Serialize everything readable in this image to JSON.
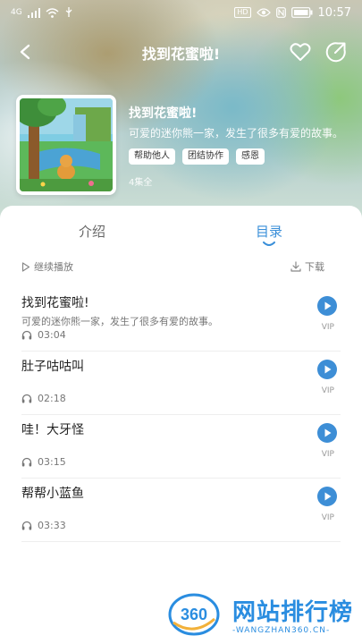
{
  "status_bar": {
    "network": "4G",
    "hd_badge": "HD",
    "battery_icon": "battery-icon",
    "time": "10:57"
  },
  "nav": {
    "title": "找到花蜜啦!",
    "back_icon": "back-arrow-icon",
    "favorite_icon": "heart-icon",
    "share_icon": "share-icon"
  },
  "album": {
    "title": "找到花蜜啦!",
    "description": "可爱的迷你熊一家，发生了很多有爱的故事。",
    "tags": [
      "帮助他人",
      "团结协作",
      "感恩"
    ],
    "episode_count": "4集全"
  },
  "tabs": {
    "intro_label": "介绍",
    "list_label": "目录"
  },
  "toolbar": {
    "continue_label": "继续播放",
    "download_label": "下载"
  },
  "episodes": [
    {
      "title": "找到花蜜啦!",
      "description": "可爱的迷你熊一家，发生了很多有爱的故事。",
      "duration": "03:04",
      "badge": "VIP"
    },
    {
      "title": "肚子咕咕叫",
      "description": "",
      "duration": "02:18",
      "badge": "VIP"
    },
    {
      "title": "哇！大牙怪",
      "description": "",
      "duration": "03:15",
      "badge": "VIP"
    },
    {
      "title": "帮帮小蓝鱼",
      "description": "",
      "duration": "03:33",
      "badge": "VIP"
    }
  ],
  "watermark": {
    "logo_text": "360",
    "title": "网站排行榜",
    "subtitle": "-WANGZHAN360.CN-"
  },
  "colors": {
    "accent": "#3d8ed6",
    "tab_active": "#3a8fd9"
  }
}
